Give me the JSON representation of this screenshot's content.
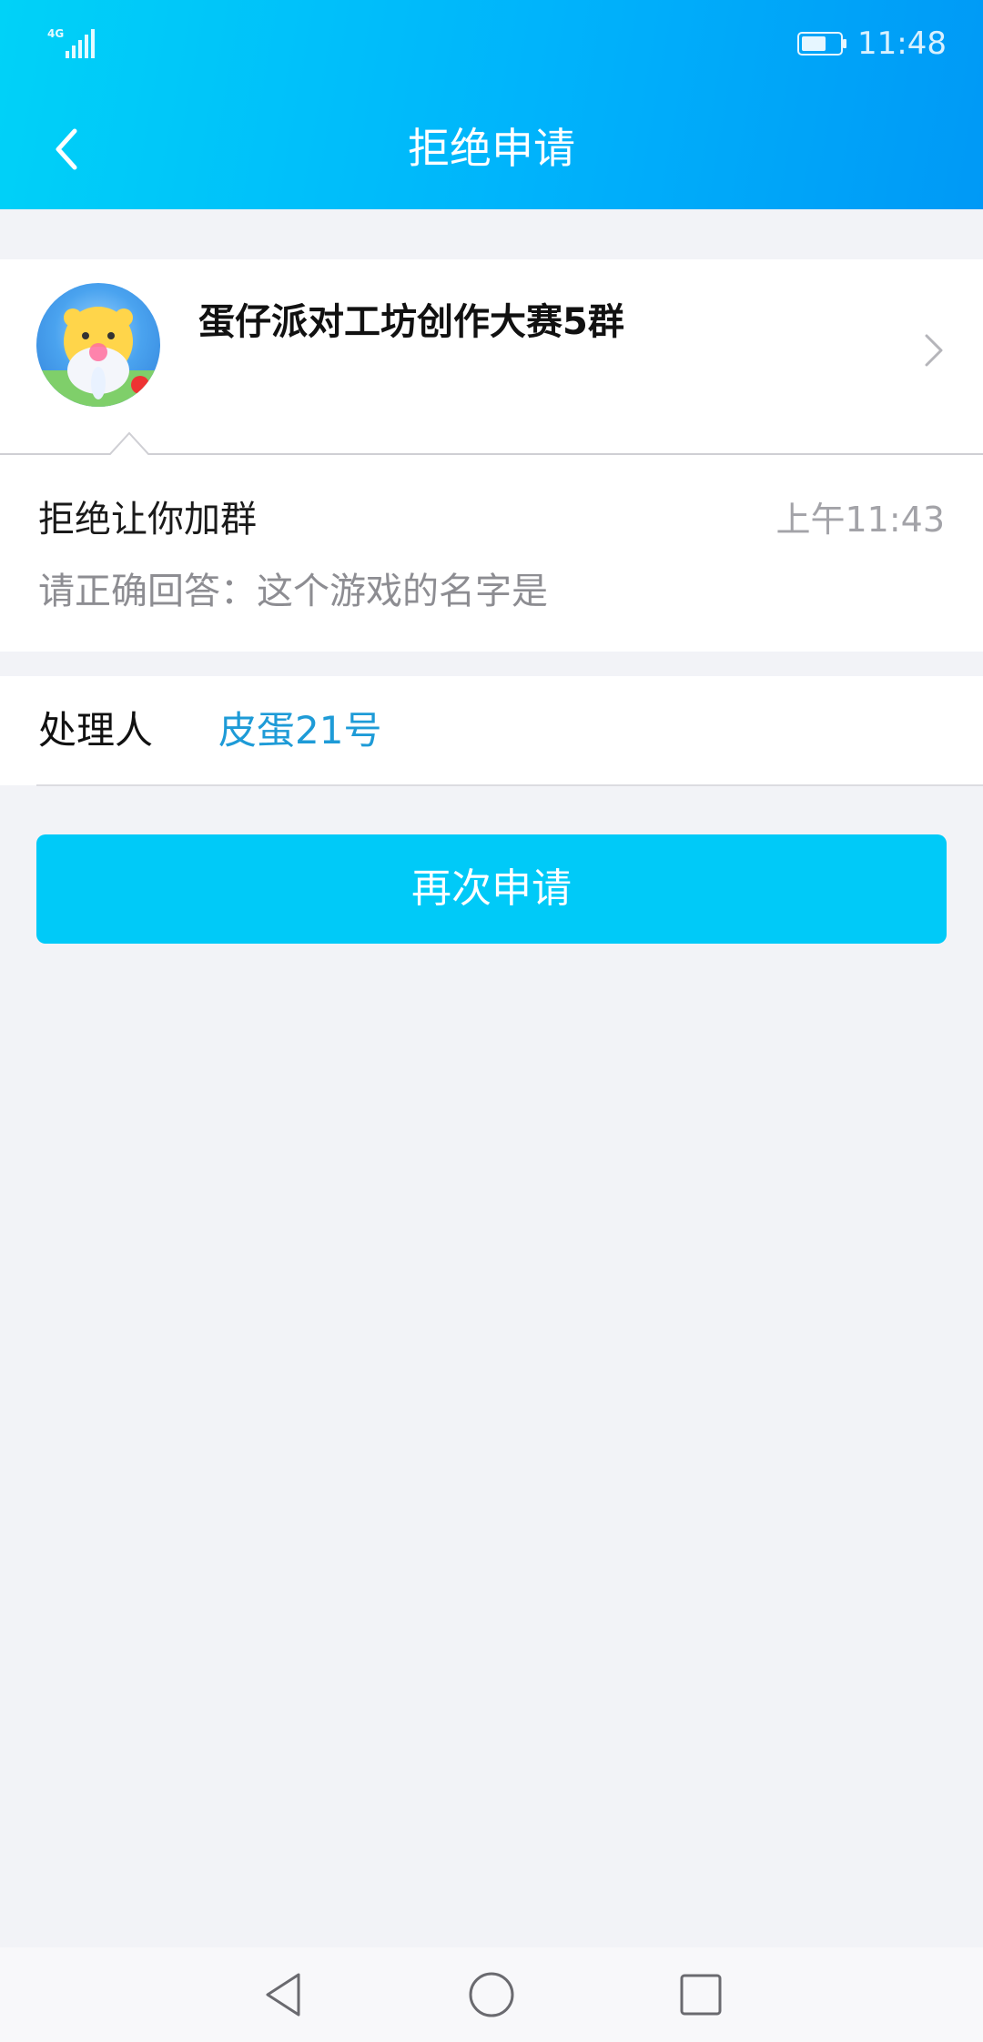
{
  "status_bar": {
    "network": "4G",
    "time": "11:48"
  },
  "header": {
    "title": "拒绝申请",
    "back_icon": "back-arrow-icon"
  },
  "group": {
    "name": "蛋仔派对工坊创作大赛5群",
    "chevron_icon": "chevron-right-icon"
  },
  "reason": {
    "title": "拒绝让你加群",
    "time": "上午11:43",
    "question": "请正确回答：这个游戏的名字是"
  },
  "handler": {
    "label": "处理人",
    "name": "皮蛋21号"
  },
  "actions": {
    "reapply_label": "再次申请"
  },
  "nav_bar": {
    "back_icon": "nav-back-icon",
    "home_icon": "nav-home-icon",
    "recent_icon": "nav-recent-icon"
  },
  "colors": {
    "header_start": "#00d2f8",
    "header_end": "#0099f6",
    "button": "#00caf8",
    "link": "#1e9bd7",
    "background": "#f2f3f7"
  }
}
